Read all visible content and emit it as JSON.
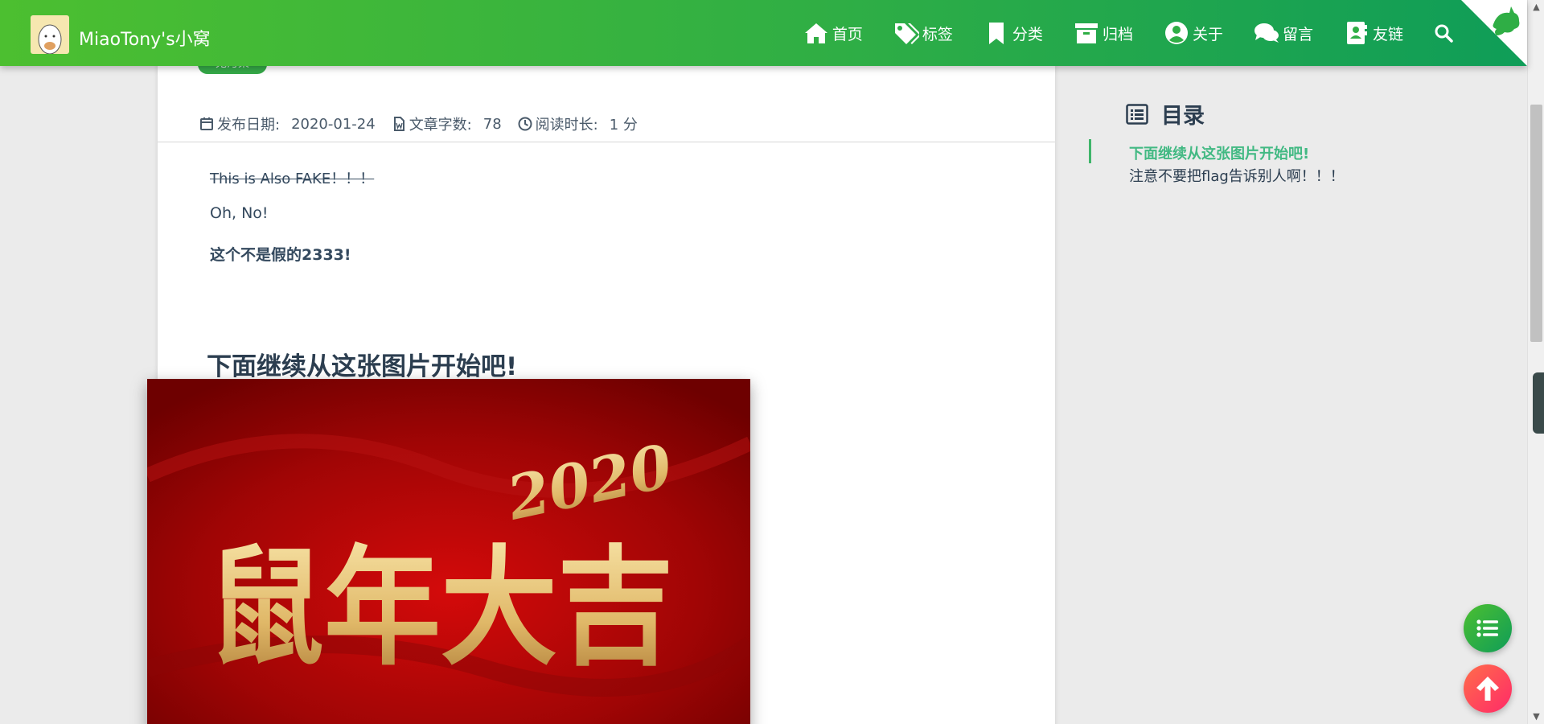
{
  "header": {
    "brand": "MiaoTony's小窝",
    "nav": [
      {
        "label": "首页",
        "icon": "home-icon"
      },
      {
        "label": "标签",
        "icon": "tags-icon"
      },
      {
        "label": "分类",
        "icon": "bookmark-icon"
      },
      {
        "label": "归档",
        "icon": "archive-icon"
      },
      {
        "label": "关于",
        "icon": "user-circle-icon"
      },
      {
        "label": "留言",
        "icon": "comments-icon"
      },
      {
        "label": "友链",
        "icon": "address-book-icon"
      }
    ],
    "search_icon": "search-icon",
    "corner_icon": "github-cat-icon"
  },
  "article": {
    "tag": "无污染",
    "meta": {
      "date_label": "发布日期:",
      "date": "2020-01-24",
      "words_label": "文章字数:",
      "words": "78",
      "read_label": "阅读时长:",
      "read": "1 分"
    },
    "strike_text": "This is Also FAKE！！！",
    "line2": "Oh, No!",
    "line3": "这个不是假的2333!",
    "heading": "下面继续从这张图片开始吧!",
    "image_text": "鼠年大吉",
    "image_year": "2020"
  },
  "toc": {
    "title": "目录",
    "items": [
      "下面继续从这张图片开始吧!",
      "注意不要把flag告诉别人啊！！！"
    ]
  },
  "colors": {
    "header_start": "#4cbf30",
    "header_end": "#0f9d58",
    "toc_active": "#42b983",
    "image_bg": "#b00808",
    "image_gold": "#e7c277"
  }
}
